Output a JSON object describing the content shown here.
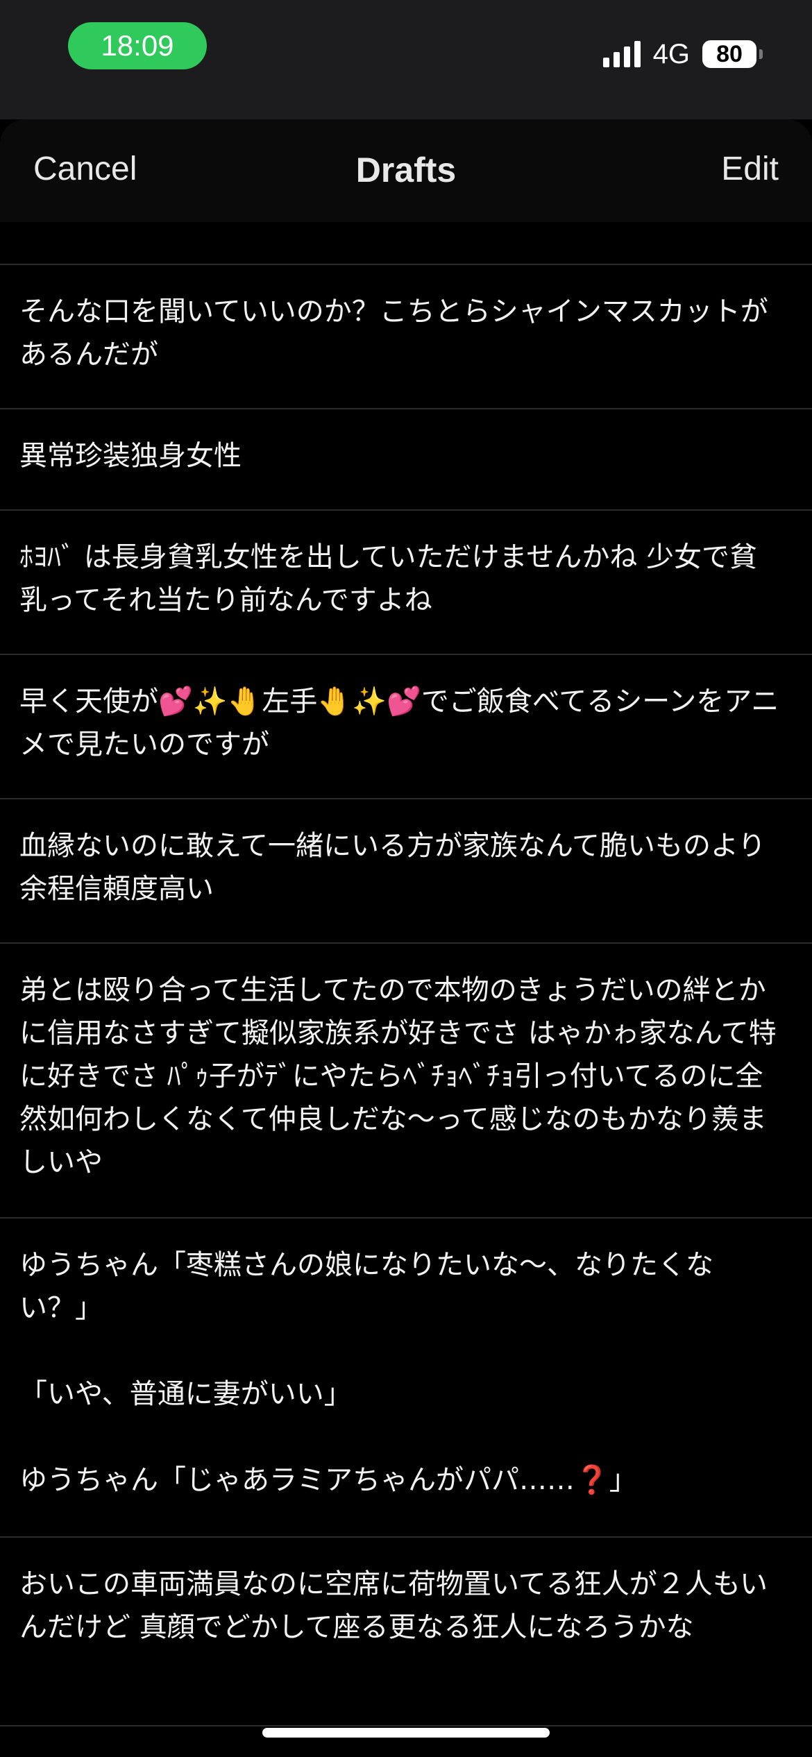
{
  "status_bar": {
    "time": "18:09",
    "network": "4G",
    "battery": "80",
    "colors": {
      "time_pill": "#30c95c",
      "background": "#1c1c1e"
    }
  },
  "nav": {
    "cancel_label": "Cancel",
    "title": "Drafts",
    "edit_label": "Edit"
  },
  "drafts": [
    {
      "text": "そんな口を聞いていいのか？こちとらシャインマスカットがあるんだが"
    },
    {
      "text": "異常珍装独身女性"
    },
    {
      "text": "ﾎﾖﾊﾞ は長身貧乳女性を出していただけませんかね 少女で貧乳ってそれ当たり前なんですよね"
    },
    {
      "text": "早く天使が💕✨🤚左手🤚✨💕でご飯食べてるシーンをアニメで見たいのですが"
    },
    {
      "text": "血縁ないのに敢えて一緒にいる方が家族なんて脆いものより余程信頼度高い"
    },
    {
      "text": "弟とは殴り合って生活してたので本物のきょうだいの絆とかに信用なさすぎて擬似家族系が好きでさ はゃかゎ家なんて特に好きでさ ﾊﾟｩ子がﾃﾞにやたらﾍﾞﾁｮﾍﾞﾁｮ引っ付いてるのに全然如何わしくなくて仲良しだな〜って感じなのもかなり羨ましいや"
    },
    {
      "text": "ゆうちゃん「枣糕さんの娘になりたいな〜、なりたくない？」\n\n「いや、普通に妻がいい」\n\nゆうちゃん「じゃあラミアちゃんがパパ……❓」"
    },
    {
      "text": "おいこの車両満員なのに空席に荷物置いてる狂人が２人もいんだけど 真顔でどかして座る更なる狂人になろうかな"
    }
  ]
}
